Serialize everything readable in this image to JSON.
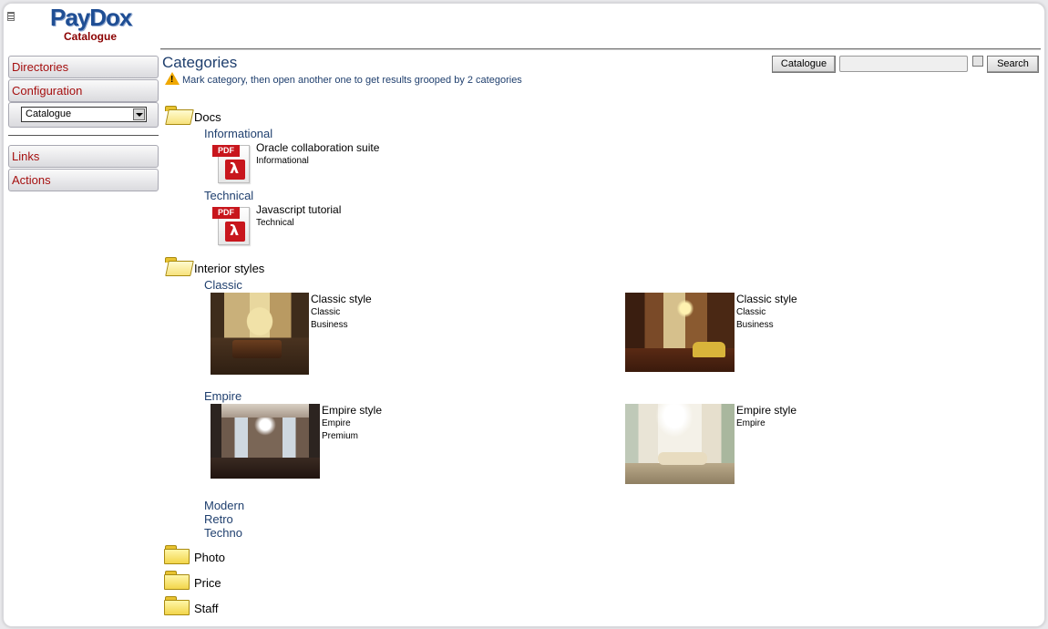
{
  "logo": {
    "title": "PayDox",
    "subtitle": "Catalogue"
  },
  "sidebar": {
    "directories_label": "Directories",
    "configuration_label": "Configuration",
    "catalogue_select_value": "Catalogue",
    "links_label": "Links",
    "actions_label": "Actions"
  },
  "header": {
    "title": "Categories",
    "hint": "Mark category, then open another one to get results grooped by 2 categories",
    "catalogue_button": "Catalogue",
    "search_button": "Search",
    "search_value": ""
  },
  "categories": {
    "docs": {
      "label": "Docs",
      "informational": {
        "label": "Informational",
        "item": {
          "icon": "pdf-icon",
          "tag": "PDF",
          "title": "Oracle collaboration suite",
          "meta": "Informational"
        }
      },
      "technical": {
        "label": "Technical",
        "item": {
          "icon": "pdf-icon",
          "tag": "PDF",
          "title": "Javascript tutorial",
          "meta": "Technical"
        }
      }
    },
    "interior": {
      "label": "Interior styles",
      "classic": {
        "label": "Classic",
        "items": [
          {
            "title": "Classic style",
            "meta1": "Classic",
            "meta2": "Business"
          },
          {
            "title": "Classic style",
            "meta1": "Classic",
            "meta2": "Business"
          }
        ]
      },
      "empire": {
        "label": "Empire",
        "items": [
          {
            "title": "Empire style",
            "meta1": "Empire",
            "meta2": "Premium"
          },
          {
            "title": "Empire style",
            "meta1": "Empire"
          }
        ]
      },
      "modern": {
        "label": "Modern"
      },
      "retro": {
        "label": "Retro"
      },
      "techno": {
        "label": "Techno"
      }
    },
    "photo": {
      "label": "Photo"
    },
    "price": {
      "label": "Price"
    },
    "staff": {
      "label": "Staff"
    }
  },
  "colors": {
    "brand_blue": "#1f4e94",
    "brand_red": "#8b0000",
    "link_blue": "#1f3f6e",
    "sidebar_text": "#a50f0f",
    "pdf_red": "#c8161d"
  }
}
